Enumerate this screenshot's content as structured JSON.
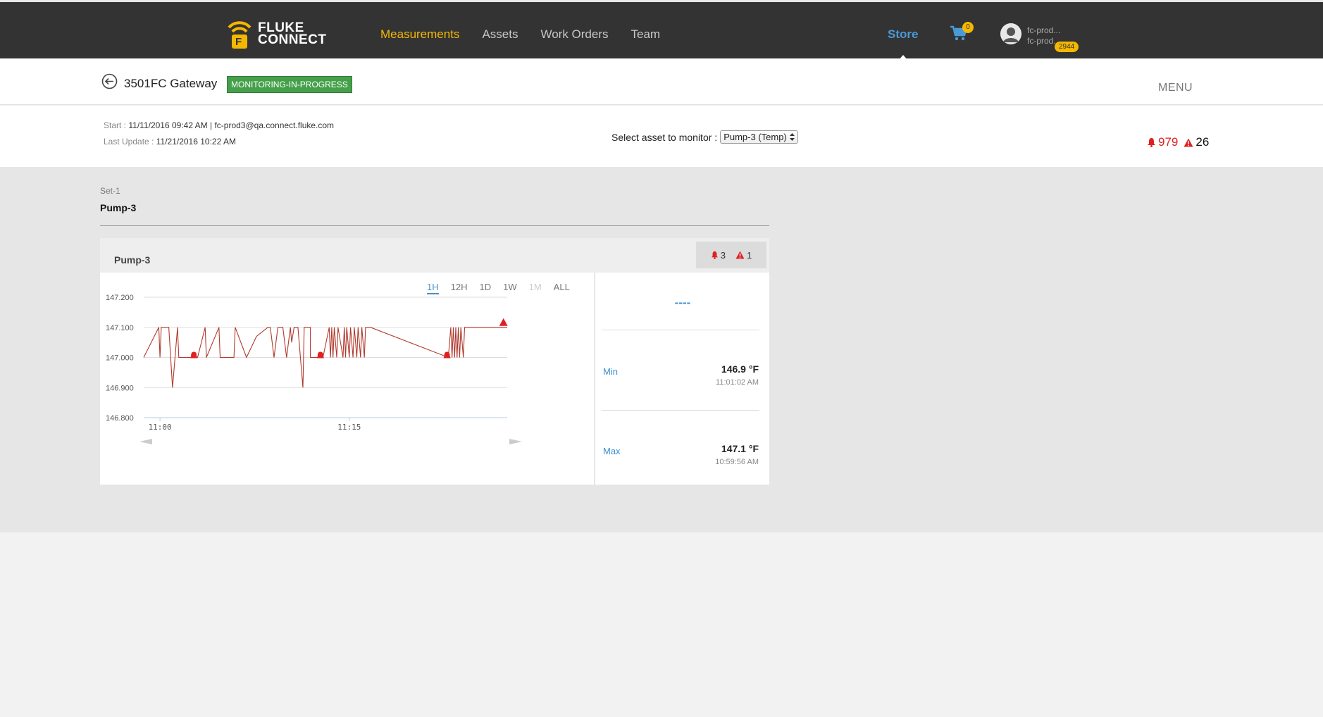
{
  "brand": {
    "line1": "FLUKE",
    "line2": "CONNECT",
    "mark": "F",
    "accent": "#f5b800"
  },
  "nav": {
    "items": [
      {
        "label": "Measurements",
        "active": true
      },
      {
        "label": "Assets"
      },
      {
        "label": "Work Orders"
      },
      {
        "label": "Team"
      }
    ],
    "store_label": "Store",
    "cart_count": "0",
    "user_line1": "fc-prod...",
    "user_line2": "fc-prod...",
    "user_badge": "2944"
  },
  "header": {
    "title": "3501FC Gateway",
    "status": "MONITORING-IN-PROGRESS",
    "menu_label": "MENU"
  },
  "info": {
    "start_label": "Start :",
    "start_value": "11/11/2016 09:42 AM | fc-prod3@qa.connect.fluke.com",
    "update_label": "Last Update :",
    "update_value": "11/21/2016 10:22 AM",
    "select_label": "Select asset to monitor :",
    "select_value": "Pump-3 (Temp)",
    "alarm_count": "979",
    "warning_count": "26"
  },
  "set": {
    "label": "Set-1",
    "title": "Pump-3"
  },
  "card": {
    "title": "Pump-3",
    "alarm_count": "3",
    "warning_count": "1",
    "ranges": [
      "1H",
      "12H",
      "1D",
      "1W",
      "1M",
      "ALL"
    ],
    "active_range": "1H",
    "disabled_range": "1M",
    "current_value": "----",
    "min_label": "Min",
    "min_value": "146.9 °F",
    "min_time": "11:01:02 AM",
    "max_label": "Max",
    "max_value": "147.1 °F",
    "max_time": "10:59:56 AM"
  },
  "chart_data": {
    "type": "line",
    "title": "",
    "xlabel": "",
    "ylabel": "",
    "ylim": [
      146.8,
      147.2
    ],
    "yticks": [
      "147.200",
      "147.100",
      "147.000",
      "146.900",
      "146.800"
    ],
    "xticks": [
      {
        "label": "11:00",
        "t": 1.3
      },
      {
        "label": "11:15",
        "t": 16.4
      }
    ],
    "xlim": [
      0,
      29
    ],
    "grid": true,
    "line_color": "#b03a2e",
    "series": [
      {
        "values": [
          [
            0,
            147.0
          ],
          [
            1.2,
            147.1
          ],
          [
            1.3,
            147.0
          ],
          [
            1.4,
            147.1
          ],
          [
            2.0,
            147.1
          ],
          [
            2.3,
            146.9
          ],
          [
            2.7,
            147.1
          ],
          [
            2.8,
            147.0
          ],
          [
            4.3,
            147.0
          ],
          [
            4.9,
            147.1
          ],
          [
            5.0,
            147.0
          ],
          [
            6.0,
            147.1
          ],
          [
            6.1,
            147.0
          ],
          [
            6.3,
            147.0
          ],
          [
            7.2,
            147.0
          ],
          [
            7.3,
            147.1
          ],
          [
            8.2,
            147.0
          ],
          [
            9.0,
            147.07
          ],
          [
            9.9,
            147.1
          ],
          [
            10.1,
            147.1
          ],
          [
            10.4,
            147.0
          ],
          [
            10.7,
            147.1
          ],
          [
            11.1,
            147.1
          ],
          [
            11.4,
            147.0
          ],
          [
            11.7,
            147.1
          ],
          [
            11.8,
            147.05
          ],
          [
            12.0,
            147.1
          ],
          [
            12.3,
            147.1
          ],
          [
            12.7,
            146.9
          ],
          [
            12.8,
            147.1
          ],
          [
            13.3,
            147.1
          ],
          [
            13.3,
            147.0
          ],
          [
            14.3,
            147.0
          ],
          [
            14.8,
            147.1
          ],
          [
            14.9,
            147.0
          ],
          [
            15.0,
            147.1
          ],
          [
            15.1,
            147.0
          ],
          [
            15.2,
            147.1
          ],
          [
            15.4,
            147.0
          ],
          [
            15.5,
            147.1
          ],
          [
            15.9,
            147.0
          ],
          [
            16.0,
            147.1
          ],
          [
            16.1,
            147.0
          ],
          [
            16.2,
            147.1
          ],
          [
            16.4,
            147.0
          ],
          [
            16.5,
            147.1
          ],
          [
            16.7,
            147.0
          ],
          [
            16.8,
            147.1
          ],
          [
            17.0,
            147.0
          ],
          [
            17.1,
            147.1
          ],
          [
            17.3,
            147.0
          ],
          [
            17.4,
            147.1
          ],
          [
            17.6,
            147.0
          ],
          [
            17.7,
            147.1
          ],
          [
            18.1,
            147.1
          ],
          [
            24.3,
            147.0
          ],
          [
            24.5,
            147.1
          ],
          [
            24.6,
            147.0
          ],
          [
            24.7,
            147.1
          ],
          [
            24.8,
            147.0
          ],
          [
            24.9,
            147.1
          ],
          [
            25.0,
            147.0
          ],
          [
            25.1,
            147.1
          ],
          [
            25.2,
            147.0
          ],
          [
            25.3,
            147.1
          ],
          [
            25.5,
            147.0
          ],
          [
            25.6,
            147.1
          ],
          [
            29.0,
            147.1
          ]
        ]
      }
    ],
    "alarm_markers": [
      [
        4.0,
        147.0
      ],
      [
        14.1,
        147.0
      ],
      [
        24.2,
        147.0
      ]
    ],
    "warning_markers": [
      [
        28.7,
        147.1
      ]
    ]
  }
}
